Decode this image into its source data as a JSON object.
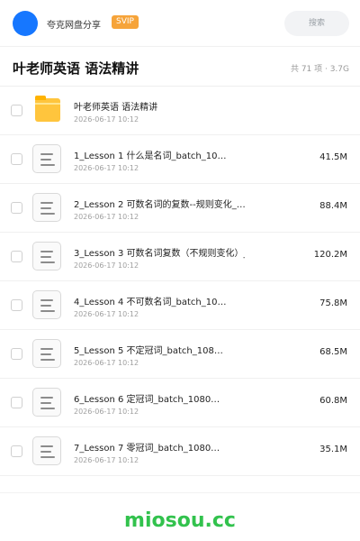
{
  "topbar": {
    "share_name": "夸克网盘分享",
    "badge": "SVIP",
    "search_placeholder": "搜索",
    "avatar_color": "#1677ff"
  },
  "header": {
    "title": "叶老师英语 语法精讲",
    "meta": "共 71 项 · 3.7G"
  },
  "items": [
    {
      "type": "folder",
      "name": "叶老师英语 语法精讲",
      "date": "2026-06-17 10:12",
      "size": ""
    },
    {
      "type": "file",
      "name": "1_Lesson 1 什么是名词_batch_10…",
      "date": "2026-06-17 10:12",
      "size": "41.5M"
    },
    {
      "type": "file",
      "name": "2_Lesson 2 可数名词的复数--规则变化_…",
      "date": "2026-06-17 10:12",
      "size": "88.4M"
    },
    {
      "type": "file",
      "name": "3_Lesson 3 可数名词复数（不规则变化）_…",
      "date": "2026-06-17 10:12",
      "size": "120.2M"
    },
    {
      "type": "file",
      "name": "4_Lesson 4 不可数名词_batch_10…",
      "date": "2026-06-17 10:12",
      "size": "75.8M"
    },
    {
      "type": "file",
      "name": "5_Lesson 5 不定冠词_batch_108…",
      "date": "2026-06-17 10:12",
      "size": "68.5M"
    },
    {
      "type": "file",
      "name": "6_Lesson 6 定冠词_batch_1080…",
      "date": "2026-06-17 10:12",
      "size": "60.8M"
    },
    {
      "type": "file",
      "name": "7_Lesson 7 零冠词_batch_1080…",
      "date": "2026-06-17 10:12",
      "size": "35.1M"
    }
  ],
  "footer": {
    "brand": "miosou.cc",
    "brand_color": "#32c24d"
  }
}
